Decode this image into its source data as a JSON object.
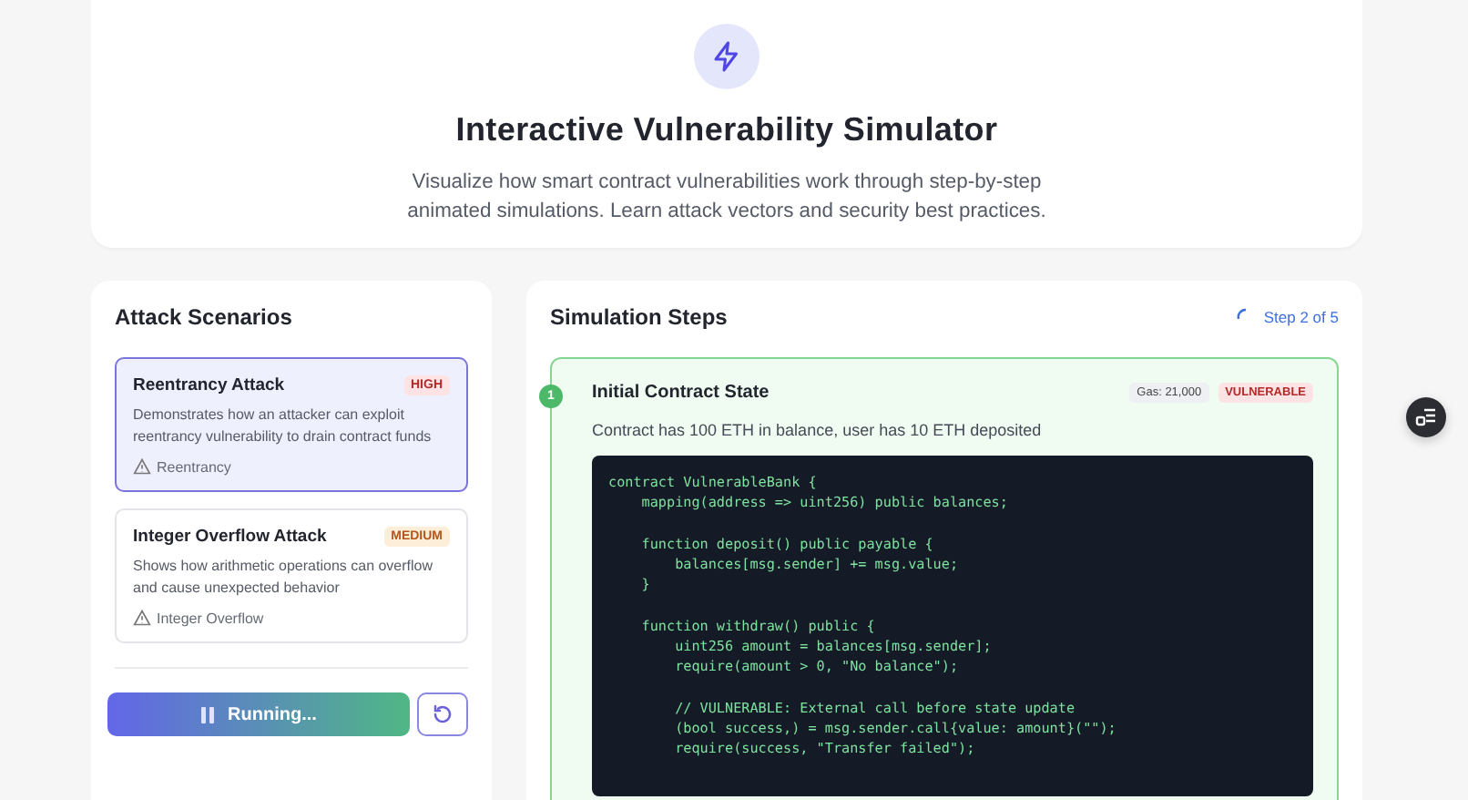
{
  "hero": {
    "title": "Interactive Vulnerability Simulator",
    "description": "Visualize how smart contract vulnerabilities work through step-by-step animated simulations. Learn attack vectors and security best practices."
  },
  "scenarios_panel": {
    "title": "Attack Scenarios",
    "scenarios": [
      {
        "title": "Reentrancy Attack",
        "severity": "HIGH",
        "kind": "high",
        "description": "Demonstrates how an attacker can exploit reentrancy vulnerability to drain contract funds",
        "category": "Reentrancy",
        "selected": true
      },
      {
        "title": "Integer Overflow Attack",
        "severity": "MEDIUM",
        "kind": "medium",
        "description": "Shows how arithmetic operations can overflow and cause unexpected behavior",
        "category": "Integer Overflow",
        "selected": false
      }
    ],
    "run_button": {
      "label": "Running...",
      "running": true
    }
  },
  "steps_panel": {
    "title": "Simulation Steps",
    "progress": {
      "label": "Step 2 of 5",
      "loading": true
    },
    "steps": [
      {
        "number": "1",
        "title": "Initial Contract State",
        "gas": "Gas: 21,000",
        "status": "VULNERABLE",
        "description": "Contract has 100 ETH in balance, user has 10 ETH deposited",
        "completed": true,
        "code_blocks": [
          [
            "contract VulnerableBank {",
            "    mapping(address => uint256) public balances;"
          ],
          [
            "    function deposit() public payable {",
            "        balances[msg.sender] += msg.value;",
            "    }"
          ],
          [
            "    function withdraw() public {",
            "        uint256 amount = balances[msg.sender];",
            "        require(amount > 0, \"No balance\");"
          ],
          [
            "        // VULNERABLE: External call before state update",
            "        (bool success,) = msg.sender.call{value: amount}(\"\");",
            "        require(success, \"Transfer failed\");"
          ]
        ]
      }
    ]
  }
}
